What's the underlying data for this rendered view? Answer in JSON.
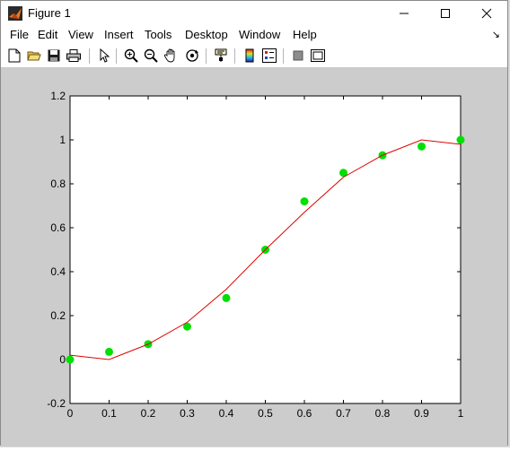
{
  "window": {
    "title": "Figure 1",
    "minimize_icon": "minimize-icon",
    "maximize_icon": "maximize-icon",
    "close_icon": "close-icon"
  },
  "menu": {
    "items": [
      {
        "label": "File"
      },
      {
        "label": "Edit"
      },
      {
        "label": "View"
      },
      {
        "label": "Insert"
      },
      {
        "label": "Tools"
      },
      {
        "label": "Desktop"
      },
      {
        "label": "Window"
      },
      {
        "label": "Help"
      }
    ],
    "dock_icon": "dock-arrow-icon"
  },
  "toolbar": {
    "buttons": [
      "new-figure-icon",
      "open-file-icon",
      "save-icon",
      "print-icon",
      "edit-plot-icon",
      "zoom-in-icon",
      "zoom-out-icon",
      "pan-icon",
      "rotate-3d-icon",
      "data-cursor-icon",
      "colorbar-icon",
      "legend-icon",
      "hide-plot-tools-icon",
      "show-plot-tools-icon"
    ]
  },
  "colors": {
    "line": "#e00000",
    "points": "#00e000",
    "axes_bg": "#ffffff",
    "figure_bg": "#cccccc"
  },
  "chart_data": {
    "type": "scatter",
    "title": "",
    "xlabel": "",
    "ylabel": "",
    "xlim": [
      0,
      1
    ],
    "ylim": [
      -0.2,
      1.2
    ],
    "xticks": [
      "0",
      "0.1",
      "0.2",
      "0.3",
      "0.4",
      "0.5",
      "0.6",
      "0.7",
      "0.8",
      "0.9",
      "1"
    ],
    "yticks": [
      "-0.2",
      "0",
      "0.2",
      "0.4",
      "0.6",
      "0.8",
      "1",
      "1.2"
    ],
    "grid": false,
    "series": [
      {
        "type": "scatter",
        "color": "#00e000",
        "x": [
          0,
          0.1,
          0.2,
          0.3,
          0.4,
          0.5,
          0.6,
          0.7,
          0.8,
          0.9,
          1.0
        ],
        "y": [
          0.0,
          0.035,
          0.07,
          0.15,
          0.28,
          0.5,
          0.72,
          0.85,
          0.93,
          0.97,
          1.0
        ]
      },
      {
        "type": "line",
        "color": "#e00000",
        "x": [
          0,
          0.1,
          0.2,
          0.3,
          0.4,
          0.5,
          0.6,
          0.7,
          0.8,
          0.9,
          1.0
        ],
        "y": [
          0.02,
          0.0,
          0.07,
          0.17,
          0.32,
          0.5,
          0.67,
          0.83,
          0.93,
          1.0,
          0.98
        ]
      }
    ]
  }
}
